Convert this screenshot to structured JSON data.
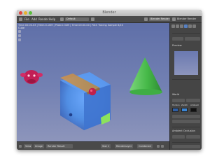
{
  "window": {
    "title": "Blender"
  },
  "menubar": {
    "items": [
      "File",
      "Add",
      "Render",
      "Help"
    ],
    "layout": "Default",
    "render_engine": "Blender Render"
  },
  "viewport": {
    "info": "Time:00:00.03 | Mem:0.16M | Peak:0.34M | Time:00:00.00 | Path Tracing Sample 6/10",
    "sub": "Cube"
  },
  "properties": {
    "preview_label": "Preview",
    "world_label": "World",
    "color_labels": [
      "Horizon",
      "Zenith",
      "Ambient"
    ],
    "ambient_occlusion_label": "Ambient Occlusion",
    "swatch_colors": [
      "#2f5fa5",
      "#3a86d6",
      "#111111"
    ]
  },
  "bottombar": {
    "view": "View",
    "image": "Image",
    "mode": "Render Result",
    "slot": "Slot 1",
    "layer": "RenderLayer",
    "combined": "Combined"
  },
  "colors": {
    "viewport_top": "#5f6fa8",
    "viewport_bottom": "#8d95bb",
    "cone": "#45b847",
    "cube": "#4f8fe6",
    "monkey": "#c0204a",
    "orange_mat": "#d3944a"
  }
}
